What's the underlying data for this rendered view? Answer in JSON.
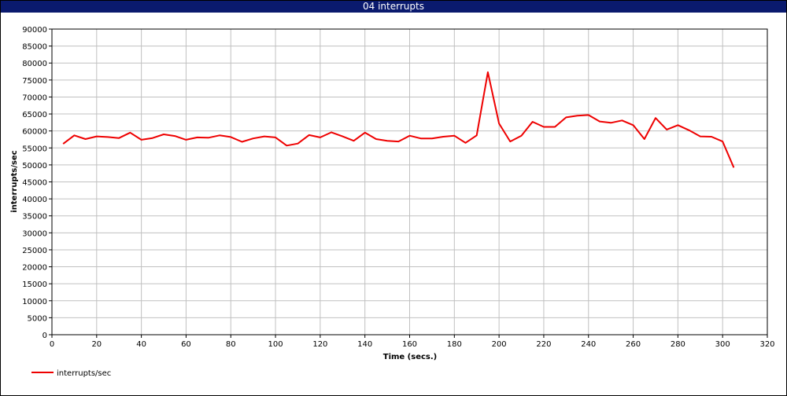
{
  "window": {
    "title": "04 interrupts"
  },
  "colors": {
    "series": "#ee0000",
    "title_bar": "#0a1a6e",
    "grid": "#c0c0c0"
  },
  "chart_data": {
    "type": "line",
    "title": "04 interrupts",
    "xlabel": "Time (secs.)",
    "ylabel": "interrupts/sec",
    "xlim": [
      0,
      320
    ],
    "ylim": [
      0,
      90000
    ],
    "xticks": [
      0,
      20,
      40,
      60,
      80,
      100,
      120,
      140,
      160,
      180,
      200,
      220,
      240,
      260,
      280,
      300,
      320
    ],
    "yticks": [
      0,
      5000,
      10000,
      15000,
      20000,
      25000,
      30000,
      35000,
      40000,
      45000,
      50000,
      55000,
      60000,
      65000,
      70000,
      75000,
      80000,
      85000,
      90000
    ],
    "grid": true,
    "legend_position": "bottom-left",
    "series": [
      {
        "name": "interrupts/sec",
        "x": [
          5,
          10,
          15,
          20,
          25,
          30,
          35,
          40,
          45,
          50,
          55,
          60,
          65,
          70,
          75,
          80,
          85,
          90,
          95,
          100,
          105,
          110,
          115,
          120,
          125,
          130,
          135,
          140,
          145,
          150,
          155,
          160,
          165,
          170,
          175,
          180,
          185,
          190,
          195,
          200,
          205,
          210,
          215,
          220,
          225,
          230,
          235,
          240,
          245,
          250,
          255,
          260,
          265,
          270,
          275,
          280,
          285,
          290,
          295,
          300,
          305
        ],
        "y": [
          56200,
          58700,
          57600,
          58400,
          58200,
          57900,
          59500,
          57400,
          57900,
          59000,
          58500,
          57400,
          58100,
          58000,
          58700,
          58200,
          56800,
          57800,
          58400,
          58100,
          55700,
          56300,
          58800,
          58100,
          59600,
          58400,
          57100,
          59500,
          57600,
          57100,
          56900,
          58600,
          57800,
          57800,
          58300,
          58600,
          56500,
          58700,
          77300,
          62200,
          56900,
          58600,
          62700,
          61200,
          61200,
          64000,
          64500,
          64700,
          62800,
          62400,
          63100,
          61700,
          57600,
          63800,
          60400,
          61700,
          60200,
          58400,
          58300,
          56900,
          49200
        ]
      }
    ]
  }
}
